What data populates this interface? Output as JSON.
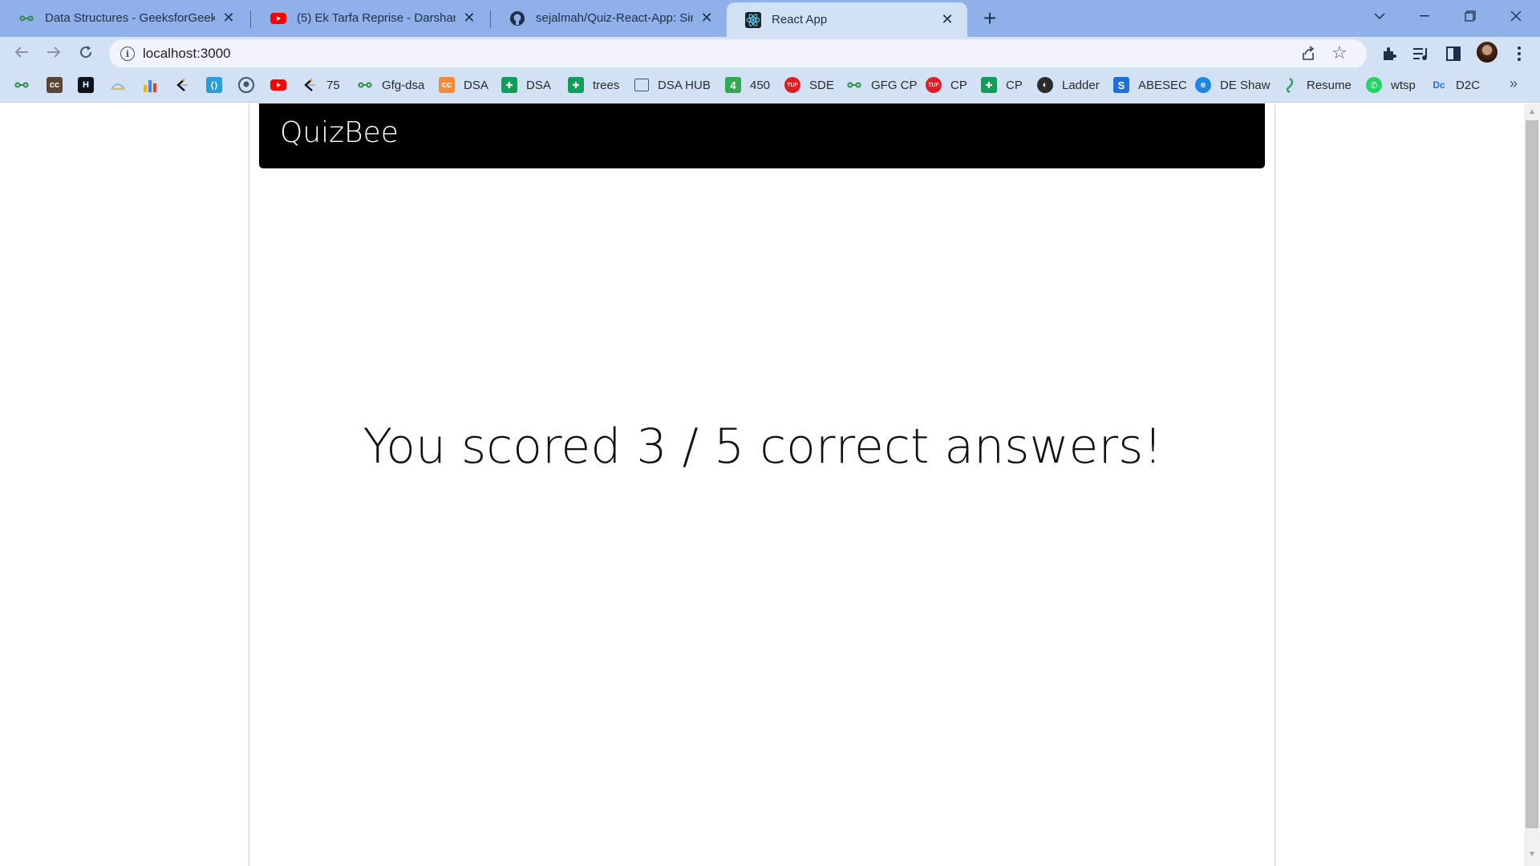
{
  "browser": {
    "tabs": [
      {
        "title": "Data Structures - GeeksforGeeks",
        "icon": "gfg-icon"
      },
      {
        "title": "(5) Ek Tarfa Reprise - Darshan Ra",
        "icon": "youtube-icon"
      },
      {
        "title": "sejalmah/Quiz-React-App: Simple",
        "icon": "github-icon"
      },
      {
        "title": "React App",
        "icon": "react-icon",
        "active": true
      }
    ],
    "url": "localhost:3000",
    "bookmarks": [
      {
        "label": "",
        "icon": "gfg-icon"
      },
      {
        "label": "",
        "icon": "codechef-icon"
      },
      {
        "label": "",
        "icon": "hackerrank-icon"
      },
      {
        "label": "",
        "icon": "hackerearth-icon"
      },
      {
        "label": "",
        "icon": "chart-icon"
      },
      {
        "label": "",
        "icon": "leetcode-icon"
      },
      {
        "label": "",
        "icon": "code-icon"
      },
      {
        "label": "",
        "icon": "github-icon"
      },
      {
        "label": "",
        "icon": "youtube-icon"
      },
      {
        "label": "75",
        "icon": "leetcode-icon"
      },
      {
        "label": "Gfg-dsa",
        "icon": "gfg-icon"
      },
      {
        "label": "DSA",
        "icon": "codechef-icon"
      },
      {
        "label": "DSA",
        "icon": "sheets-icon"
      },
      {
        "label": "trees",
        "icon": "sheets-icon"
      },
      {
        "label": "DSA HUB",
        "icon": "page-icon"
      },
      {
        "label": "450",
        "icon": "four-icon"
      },
      {
        "label": "SDE",
        "icon": "tuf-icon"
      },
      {
        "label": "GFG CP",
        "icon": "gfg-icon"
      },
      {
        "label": "CP",
        "icon": "tuf-icon"
      },
      {
        "label": "CP",
        "icon": "sheets-icon"
      },
      {
        "label": "Ladder",
        "icon": "globe-icon"
      },
      {
        "label": "ABESEC",
        "icon": "s-icon"
      },
      {
        "label": "DE Shaw",
        "icon": "edge-icon"
      },
      {
        "label": "Resume",
        "icon": "resume-icon"
      },
      {
        "label": "wtsp",
        "icon": "whatsapp-icon"
      },
      {
        "label": "D2C",
        "icon": "d2c-icon"
      }
    ]
  },
  "app": {
    "title": "QuizBee",
    "score_text": "You scored 3 / 5 correct answers!"
  },
  "colors": {
    "tabstrip": "#8fb0e8",
    "toolbar": "#d3e1f5",
    "header": "#000000"
  }
}
